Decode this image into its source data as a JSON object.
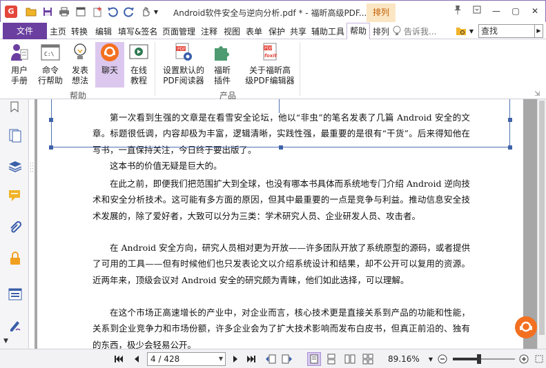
{
  "titlebar": {
    "app_logo": "G",
    "title": "Android软件安全与逆向分析.pdf * - 福昕高级PDF...",
    "context_tab": "排列",
    "icons": [
      "app-logo-icon",
      "open-folder-icon",
      "save-icon",
      "print-icon",
      "new-window-icon",
      "sparkle-icon",
      "undo-icon",
      "redo-icon",
      "hand-tool-icon",
      "dropdown-arrow-icon"
    ],
    "window_buttons": {
      "pin": "📌",
      "ribbon_options": "□",
      "minimize": "—",
      "maximize": "▢",
      "close": "✕"
    }
  },
  "menubar": {
    "file": "文件",
    "items": [
      "主页",
      "转换",
      "编辑",
      "填写&签名",
      "页面管理",
      "注释",
      "视图",
      "表单",
      "保护",
      "共享",
      "辅助工具"
    ],
    "active": "帮助",
    "context": "排列",
    "tell_me": "告诉我...",
    "search_placeholder": "查找"
  },
  "ribbon": {
    "help_group": {
      "label": "帮助",
      "buttons": [
        {
          "line1": "用户",
          "line2": "手册",
          "icon": "user-manual-icon"
        },
        {
          "line1": "命令",
          "line2": "行帮助",
          "icon": "command-line-icon"
        },
        {
          "line1": "发表",
          "line2": "想法",
          "icon": "idea-bulb-icon"
        },
        {
          "line1": "聊天",
          "line2": "",
          "icon": "chat-icon",
          "selected": true
        },
        {
          "line1": "在线",
          "line2": "教程",
          "icon": "online-tutorial-icon"
        }
      ]
    },
    "product_group": {
      "label": "产品",
      "buttons": [
        {
          "line1": "设置默认的",
          "line2": "PDF阅读器",
          "icon": "default-reader-icon"
        },
        {
          "line1": "福昕",
          "line2": "插件",
          "icon": "plugin-puzzle-icon"
        },
        {
          "line1": "关于福昕高",
          "line2": "级PDF编辑器",
          "icon": "about-foxit-icon"
        }
      ]
    },
    "pdf_badge": "PDF",
    "foxit_badge": "foxit"
  },
  "leftrail": {
    "icons": [
      "bookmark-icon",
      "pages-icon",
      "layers-icon",
      "comments-icon",
      "attachments-icon",
      "security-icon",
      "form-fields-icon",
      "signature-icon"
    ]
  },
  "document": {
    "paragraphs": [
      "第一次看到生强的文章是在看雪安全论坛，他以“非虫”的笔名发表了几篇 Android 安全的文章。标题很低调，内容却极为丰富，逻辑清晰，实践性强，最重要的是很有“干货”。后来得知他在写书，一直保持关注，今日终于要出版了。",
      "这本书的价值无疑是巨大的。",
      "在此之前，即便我们把范围扩大到全球，也没有哪本书具体而系统地专门介绍 Android 逆向技术和安全分析技术。这可能有多方面的原因，但其中最重要的一点是竞争与利益。推动信息安全技术发展的，除了爱好者，大致可以分为三类：学术研究人员、企业研发人员、攻击者。",
      "在 Android 安全方向，研究人员相对更为开放——许多团队开放了系统原型的源码，或者提供了可用的工具——但有时候他们也只发表论文以介绍系统设计和结果，却不公开可以复用的资源。近两年来，顶级会议对 Android 安全的研究颇为青睐，他们如此选择，可以理解。",
      "在这个市场正高速增长的产业中，对企业而言，核心技术更是直接关系到产品的功能和性能，关系到企业竞争力和市场份额，许多企业会为了扩大技术影响而发布白皮书，但真正前沿的、独有的东西，极少会轻易公开。"
    ]
  },
  "statusbar": {
    "page_value": "4 / 428",
    "zoom": "89.16%",
    "zoom_level_fraction": 0.42,
    "icons": [
      "first-page-icon",
      "prev-page-icon",
      "next-page-icon",
      "last-page-icon",
      "back-icon",
      "forward-icon",
      "single-page-icon",
      "continuous-icon",
      "facing-icon",
      "continuous-facing-icon",
      "zoom-out-icon",
      "zoom-in-icon",
      "fit-icon"
    ]
  },
  "colors": {
    "accent": "#6b3fa0",
    "selected_bg": "#dcc8ee",
    "context_tab_bg": "#fbe6c3",
    "chat_orange": "#f37021"
  }
}
